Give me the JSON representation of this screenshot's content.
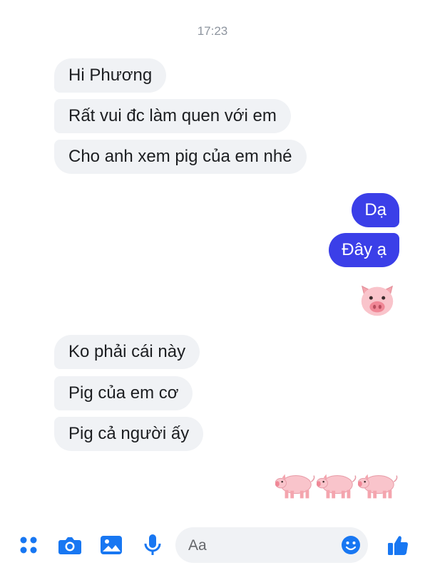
{
  "thread": {
    "timestamp": "17:23",
    "messages": [
      {
        "side": "incoming",
        "text": "Hi Phương"
      },
      {
        "side": "incoming",
        "text": "Rất vui đc làm quen với em"
      },
      {
        "side": "incoming",
        "text": "Cho anh xem pig của em nhé"
      },
      {
        "side": "outgoing",
        "text": "Dạ"
      },
      {
        "side": "outgoing",
        "text": "Đây ạ"
      },
      {
        "side": "outgoing",
        "emoji": "pig-face"
      },
      {
        "side": "incoming",
        "text": "Ko phải cái này"
      },
      {
        "side": "incoming",
        "text": "Pig của em cơ"
      },
      {
        "side": "incoming",
        "text": "Pig cả người ấy"
      },
      {
        "side": "outgoing",
        "emoji": "pig",
        "count": 3
      }
    ]
  },
  "composer": {
    "placeholder": "Aa",
    "icons": [
      "menu-dots-icon",
      "camera-icon",
      "gallery-icon",
      "microphone-icon",
      "smiley-icon",
      "thumbs-up-icon"
    ]
  },
  "colors": {
    "outgoing_bubble": "#3b3fe8",
    "incoming_bubble": "#f0f2f5",
    "accent": "#1877f2"
  }
}
